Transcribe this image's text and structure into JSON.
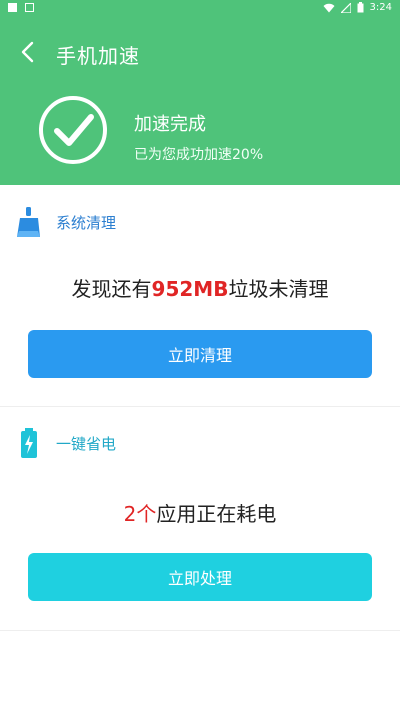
{
  "status_bar": {
    "time": "3:24"
  },
  "header": {
    "title": "手机加速",
    "result_title": "加速完成",
    "result_subtitle": "已为您成功加速20%"
  },
  "cleanup": {
    "label": "系统清理",
    "msg_prefix": "发现还有",
    "msg_value": "952MB",
    "msg_suffix": "垃圾未清理",
    "button_label": "立即清理"
  },
  "power": {
    "label": "一键省电",
    "msg_value": "2个",
    "msg_suffix": "应用正在耗电",
    "button_label": "立即处理"
  },
  "colors": {
    "header_green": "#4fc37a",
    "clean_button": "#2a9af0",
    "power_button": "#1fd0e0",
    "highlight_red": "#e02525"
  },
  "icons": {
    "back": "chevron-left-icon",
    "done": "check-circle-icon",
    "cleanup": "broom-icon",
    "power": "battery-charging-icon"
  }
}
